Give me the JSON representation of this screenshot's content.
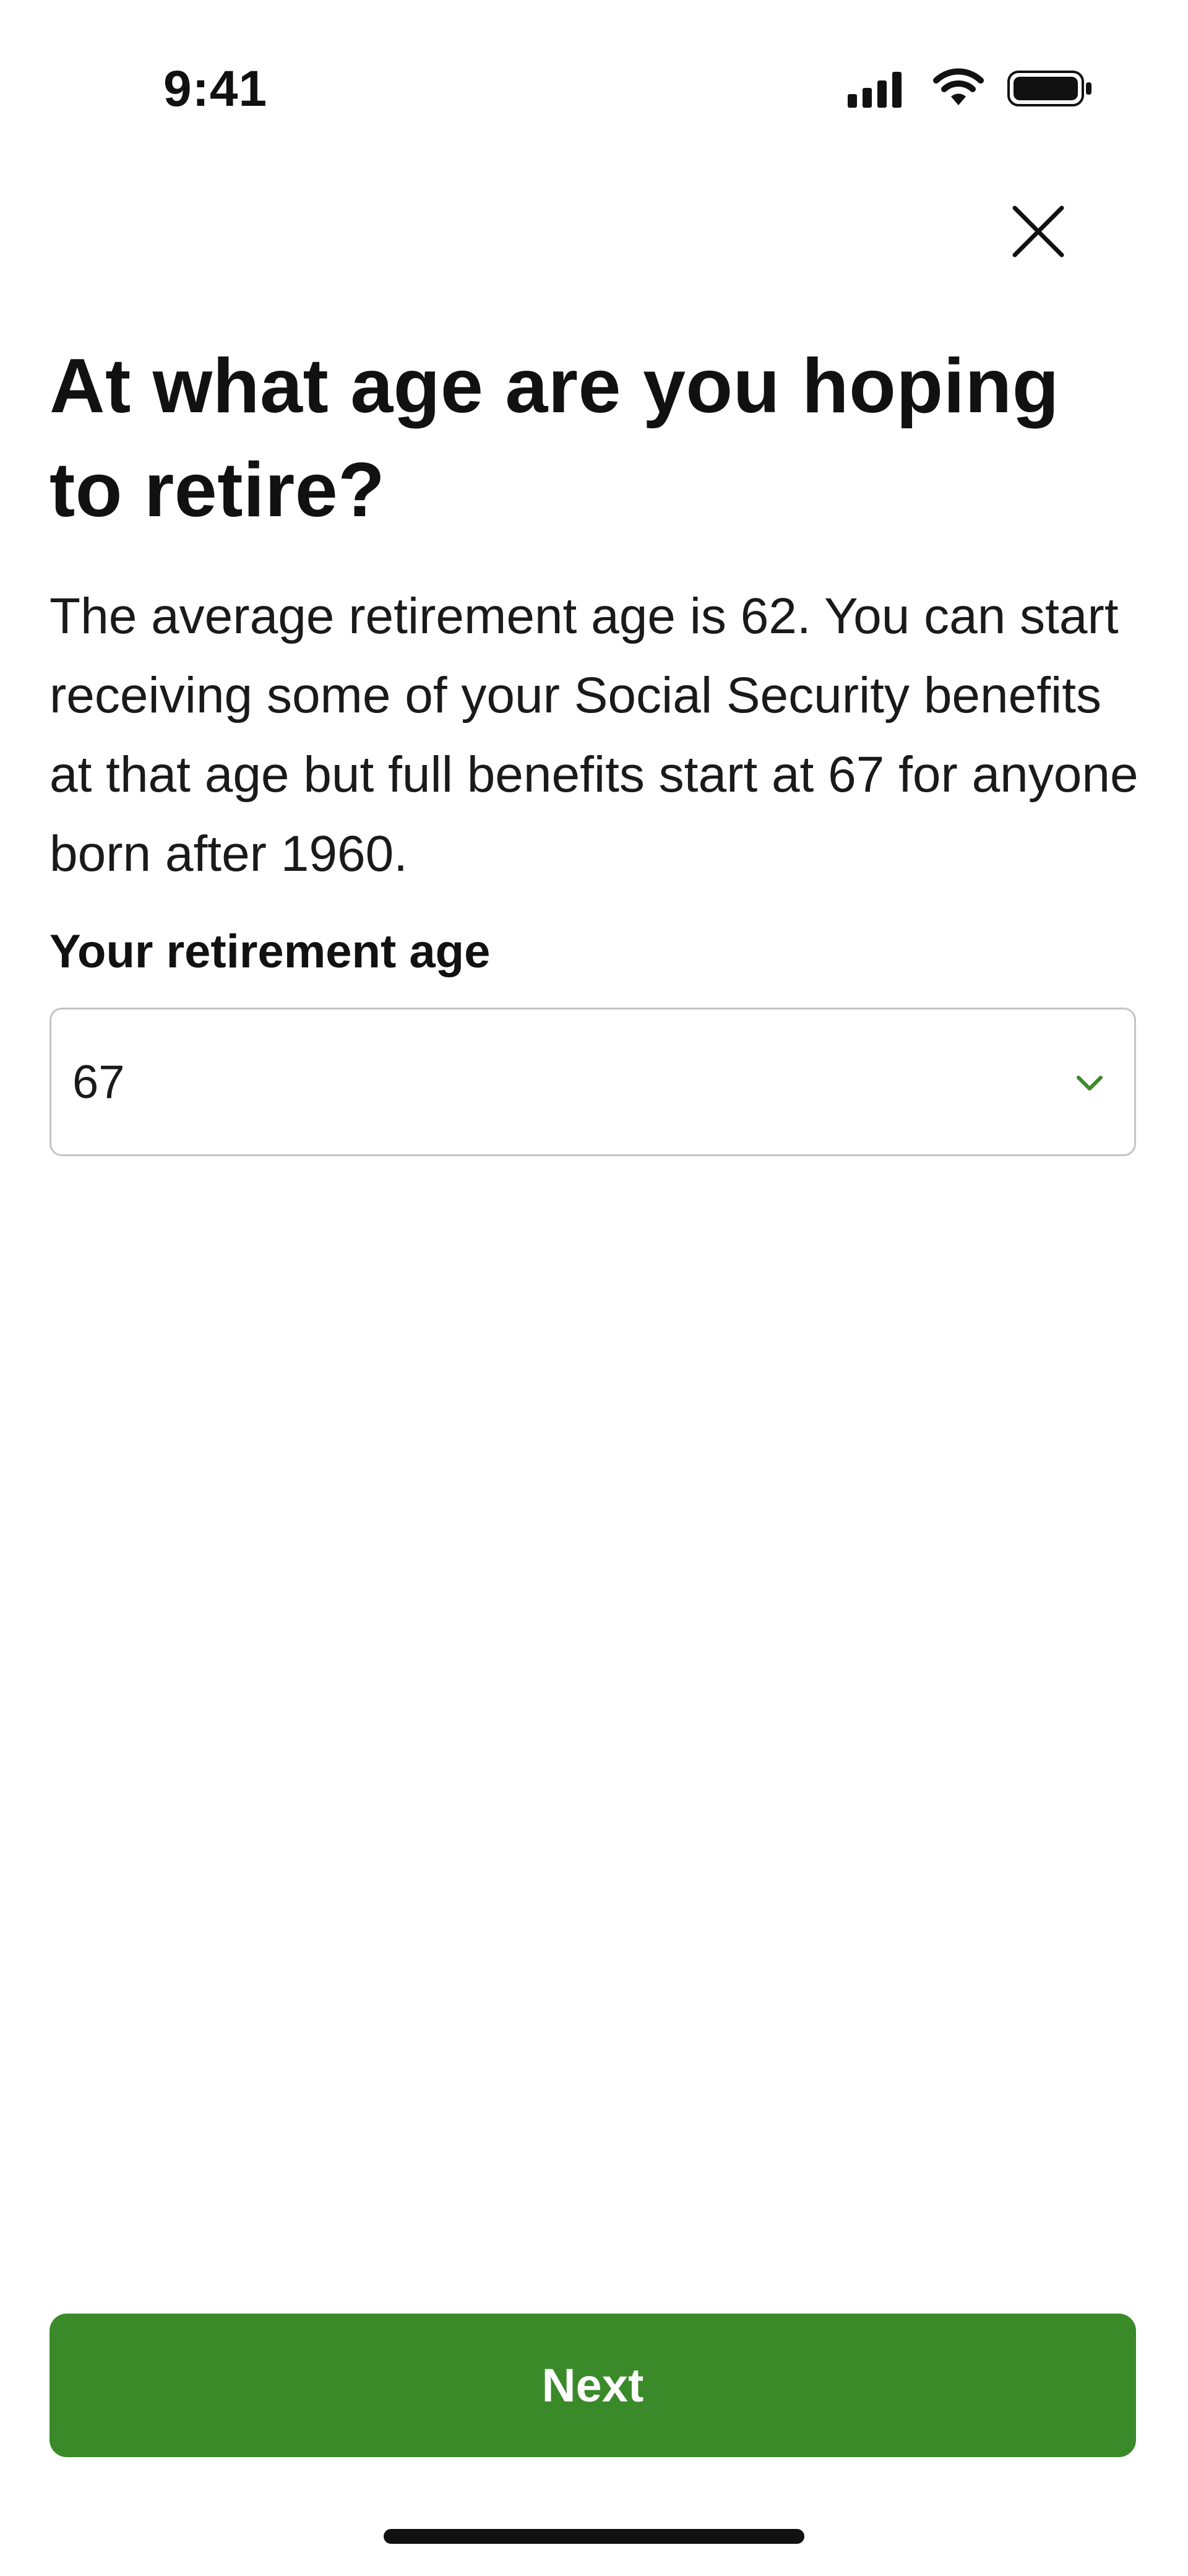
{
  "status_bar": {
    "time": "9:41",
    "icons": [
      "cellular-signal-icon",
      "wifi-icon",
      "battery-icon"
    ]
  },
  "header": {
    "close_icon": "close-icon"
  },
  "main": {
    "title": "At what age are you hoping to retire?",
    "description": "The average retirement age is 62. You can start receiving some of your Social Security benefits at that age but full benefits start at 67 for anyone born after 1960.",
    "field": {
      "label": "Your retirement age",
      "selected_value": "67",
      "chevron_icon": "chevron-down-icon"
    }
  },
  "footer": {
    "next_label": "Next"
  },
  "colors": {
    "accent": "#3a8a2a",
    "text": "#111111",
    "border": "#c4c4c4",
    "background": "#ffffff"
  }
}
